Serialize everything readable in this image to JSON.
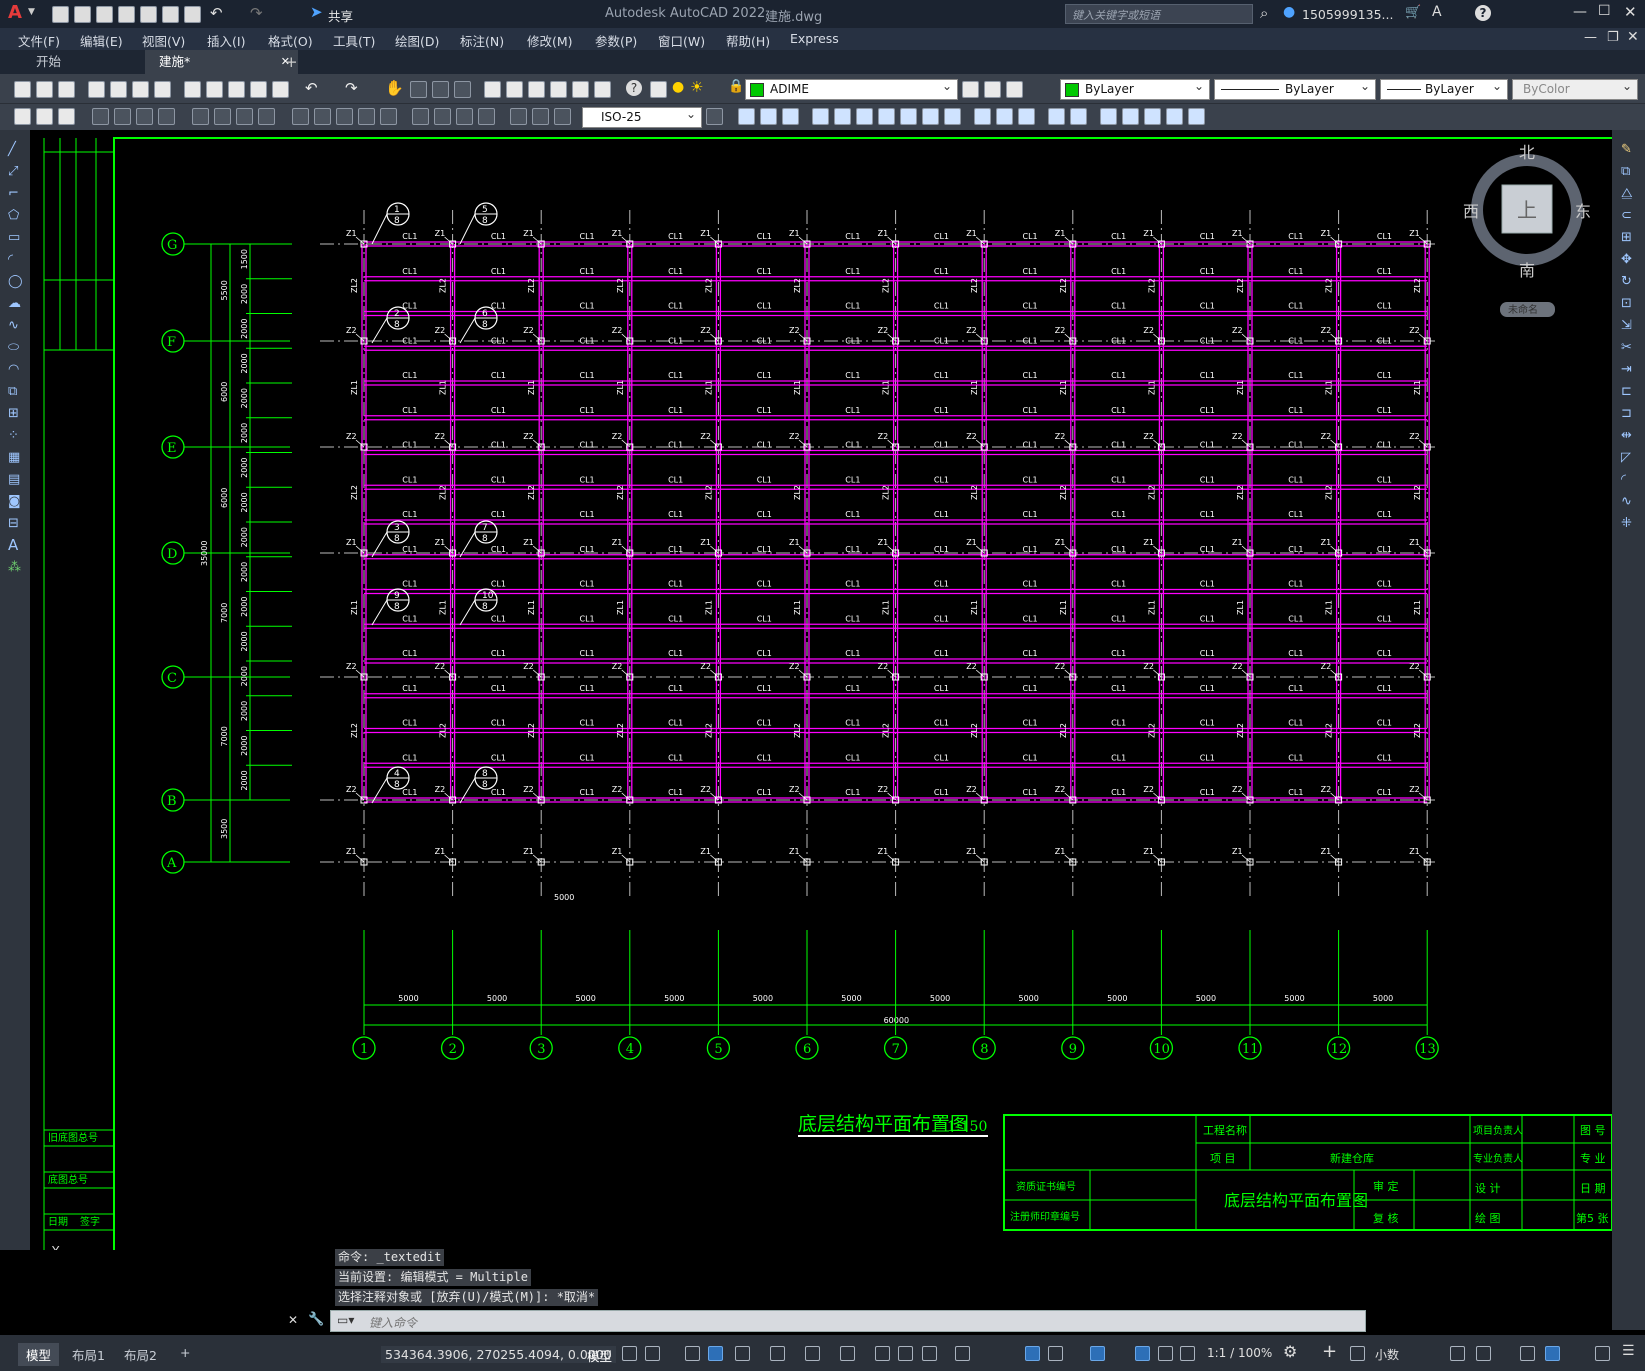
{
  "app": {
    "title": "Autodesk AutoCAD 2022",
    "filename": "建施.dwg",
    "logo": "A",
    "share_label": "共享",
    "search_placeholder": "键入关键字或短语",
    "user": "1505999135...",
    "help_icon": "?"
  },
  "menu": [
    "文件(F)",
    "编辑(E)",
    "视图(V)",
    "插入(I)",
    "格式(O)",
    "工具(T)",
    "绘图(D)",
    "标注(N)",
    "修改(M)",
    "参数(P)",
    "窗口(W)",
    "帮助(H)",
    "Express"
  ],
  "tabs": [
    {
      "label": "开始",
      "active": false
    },
    {
      "label": "建施*",
      "active": true
    }
  ],
  "tab_close": "✕",
  "tab_add": "+",
  "toolbar": {
    "layer": "ADIME",
    "color": "ByLayer",
    "linetype": "ByLayer",
    "lineweight": "ByLayer",
    "plotstyle": "ByColor",
    "dimstyle": "ISO-25"
  },
  "viewcube": {
    "north": "北",
    "south": "南",
    "east": "东",
    "west": "西",
    "top": "上",
    "wcs": "未命名"
  },
  "drawing": {
    "title": "底层结构平面布置图",
    "scale": "1:150",
    "grid_rows": [
      "G",
      "F",
      "E",
      "D",
      "C",
      "B",
      "A"
    ],
    "grid_cols": [
      "1",
      "2",
      "3",
      "4",
      "5",
      "6",
      "7",
      "8",
      "9",
      "10",
      "11",
      "12",
      "13"
    ],
    "bay_dim": "5000",
    "total_width": "60000",
    "total_height": "35000",
    "row_dims": [
      "5500",
      "6000",
      "6000",
      "7000",
      "7000",
      "3500"
    ],
    "sub_dims": [
      "1500",
      "2000",
      "2000",
      "2000",
      "2000",
      "2000",
      "2000",
      "2000",
      "2000",
      "2000",
      "2000",
      "2000",
      "2000",
      "2000",
      "2000",
      "2000"
    ],
    "beam_label": "CL1",
    "col_label_z1": "Z1",
    "col_label_z2": "Z2",
    "col_label_zl1": "ZL1",
    "col_label_zl2": "ZL2",
    "section_tags": [
      {
        "top": "1",
        "bottom": "8"
      },
      {
        "top": "5",
        "bottom": "8"
      },
      {
        "top": "2",
        "bottom": "8"
      },
      {
        "top": "6",
        "bottom": "8"
      },
      {
        "top": "3",
        "bottom": "8"
      },
      {
        "top": "7",
        "bottom": "8"
      },
      {
        "top": "9",
        "bottom": "8"
      },
      {
        "top": "10",
        "bottom": "8"
      },
      {
        "top": "4",
        "bottom": "8"
      },
      {
        "top": "8",
        "bottom": "8"
      }
    ],
    "left_stamps": [
      "旧底图总号",
      "底图总号",
      "日期",
      "签字"
    ],
    "titleblock": {
      "project_name_label": "工程名称",
      "item_label": "项 目",
      "item_value": "新建仓库",
      "drawing_name": "底层结构平面布置图",
      "qual_cert": "资质证书编号",
      "reg_stamp": "注册师印章编号",
      "review": "审 定",
      "check": "复 核",
      "design": "设 计",
      "draw": "绘 图",
      "proj_lead": "项目负责人",
      "spec_lead": "专业负责人",
      "sheet_no": "图 号",
      "spec": "专 业",
      "date": "日 期",
      "page": "第5 张"
    },
    "ucs": "Y"
  },
  "command": {
    "history": [
      "命令: _textedit",
      "当前设置: 编辑模式 = Multiple",
      "选择注释对象或 [放弃(U)/模式(M)]: *取消*"
    ],
    "placeholder": "键入命令"
  },
  "status": {
    "layout_tabs": [
      "模型",
      "布局1",
      "布局2"
    ],
    "add": "+",
    "coords": "534364.3906, 270255.4094, 0.0000",
    "model": "模型",
    "scale": "1:1 / 100%",
    "units": "小数"
  },
  "colors": {
    "background": "#000000",
    "grid": "#00ff00",
    "beams": "#ff00ff",
    "text": "#ffffff"
  }
}
